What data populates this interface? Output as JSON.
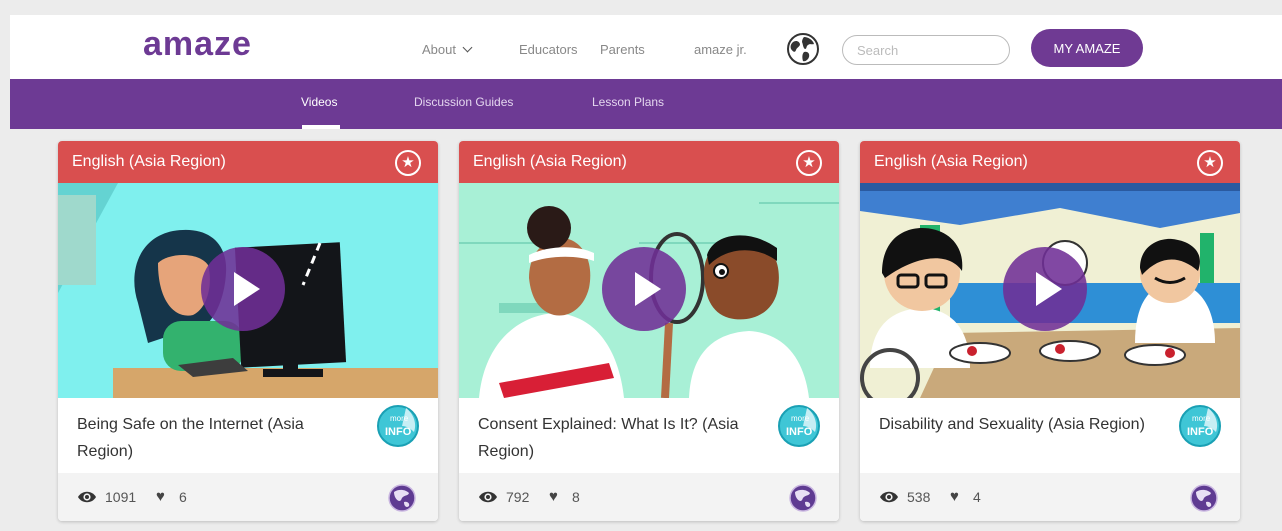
{
  "brand": {
    "logo_text": "amaze",
    "accent": "#6d3a94",
    "card_header": "#d94f4f"
  },
  "nav": {
    "about": "About",
    "educators": "Educators",
    "parents": "Parents",
    "jr": "amaze jr.",
    "search_placeholder": "Search",
    "cta": "MY AMAZE"
  },
  "subnav": {
    "videos": "Videos",
    "guides": "Discussion Guides",
    "lessons": "Lesson Plans",
    "active": "Videos"
  },
  "cards": [
    {
      "language": "English (Asia Region)",
      "title": "Being Safe on the Internet (Asia Region)",
      "views": "1091",
      "likes": "6",
      "badge_top": "more",
      "badge_bottom": "INFO"
    },
    {
      "language": "English (Asia Region)",
      "title": "Consent Explained: What Is It? (Asia Region)",
      "views": "792",
      "likes": "8",
      "badge_top": "more",
      "badge_bottom": "INFO"
    },
    {
      "language": "English (Asia Region)",
      "title": "Disability and Sexuality (Asia Region)",
      "views": "538",
      "likes": "4",
      "badge_top": "more",
      "badge_bottom": "INFO"
    }
  ],
  "icons": {
    "play": "play-icon",
    "star": "star-icon",
    "eye": "eye-icon",
    "heart": "heart-icon",
    "globe": "globe-icon",
    "region": "asia-globe-icon",
    "chevron": "chevron-down-icon"
  }
}
